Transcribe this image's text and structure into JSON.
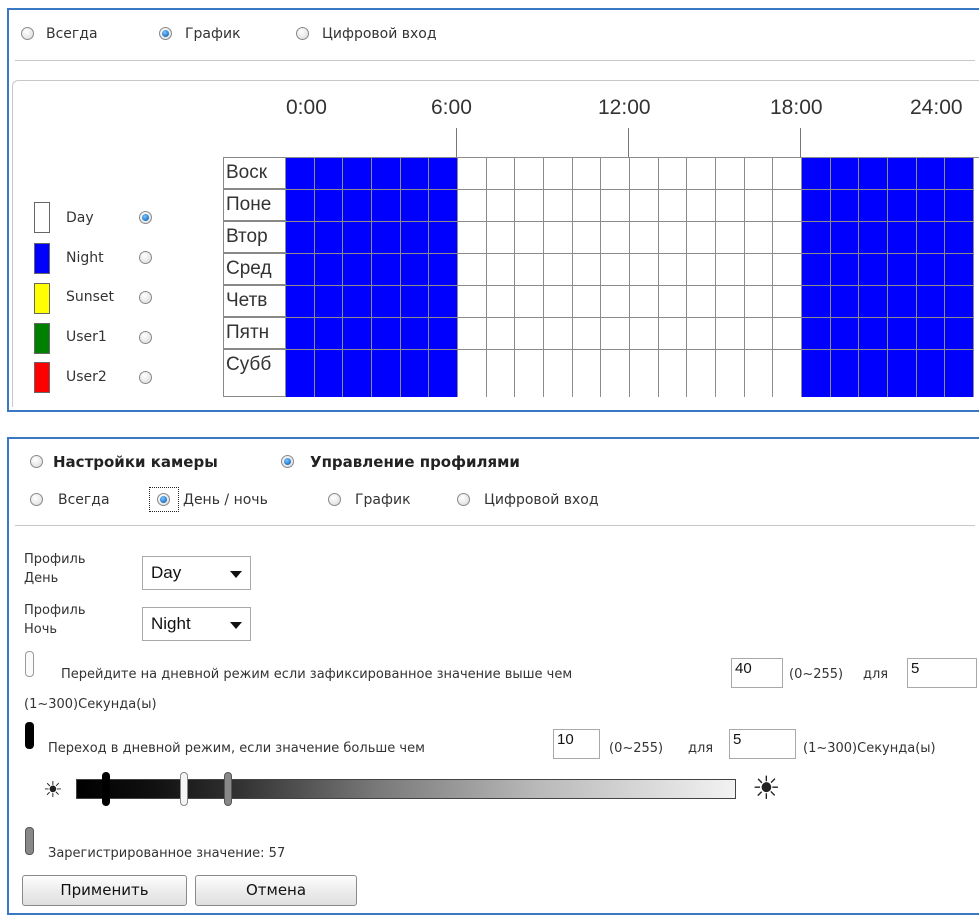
{
  "top_panel": {
    "modes": [
      {
        "label": "Всегда",
        "selected": false
      },
      {
        "label": "График",
        "selected": true
      },
      {
        "label": "Цифровой вход",
        "selected": false
      }
    ],
    "schedule": {
      "time_labels": [
        "0:00",
        "6:00",
        "12:00",
        "18:00",
        "24:00"
      ],
      "days": [
        "Воск",
        "Поне",
        "Втор",
        "Сред",
        "Четв",
        "Пятн",
        "Субб"
      ],
      "hours_night_ranges": [
        [
          0,
          6
        ],
        [
          18,
          24
        ]
      ],
      "night_color": "#0000ff",
      "day_color": "#ffffff"
    },
    "legend": [
      {
        "label": "Day",
        "color": "#ffffff",
        "selected": true
      },
      {
        "label": "Night",
        "color": "#0000ff",
        "selected": false
      },
      {
        "label": "Sunset",
        "color": "#ffff00",
        "selected": false
      },
      {
        "label": "User1",
        "color": "#008000",
        "selected": false
      },
      {
        "label": "User2",
        "color": "#ff0000",
        "selected": false
      }
    ]
  },
  "bottom_panel": {
    "top_options": [
      {
        "label": "Настройки камеры",
        "selected": false
      },
      {
        "label": "Управление профилями",
        "selected": true
      }
    ],
    "modes": [
      {
        "label": "Всегда",
        "selected": false
      },
      {
        "label": "День / ночь",
        "selected": true
      },
      {
        "label": "График",
        "selected": false
      },
      {
        "label": "Цифровой вход",
        "selected": false
      }
    ],
    "profile_day": {
      "label_line1": "Профиль",
      "label_line2": "День",
      "value": "Day"
    },
    "profile_night": {
      "label_line1": "Профиль",
      "label_line2": "Ночь",
      "value": "Night"
    },
    "rule_day": {
      "text": "Перейдите на дневной режим если зафиксированное значение выше чем",
      "threshold": "40",
      "range": "(0~255)",
      "for": "для",
      "seconds": "5",
      "seconds_range": "(1~300)Секунда(ы)"
    },
    "rule_night": {
      "text": "Переход в дневной режим, если значение больше чем",
      "threshold": "10",
      "range": "(0~255)",
      "for": "для",
      "seconds": "5",
      "seconds_range": "(1~300)Секунда(ы)"
    },
    "slider": {
      "min": 0,
      "max": 255,
      "night_marker_value": 10,
      "day_marker_value": 40,
      "current_marker_value": 57
    },
    "registered_text": "Зарегистрированное значение: 57",
    "apply_label": "Применить",
    "cancel_label": "Отмена"
  }
}
